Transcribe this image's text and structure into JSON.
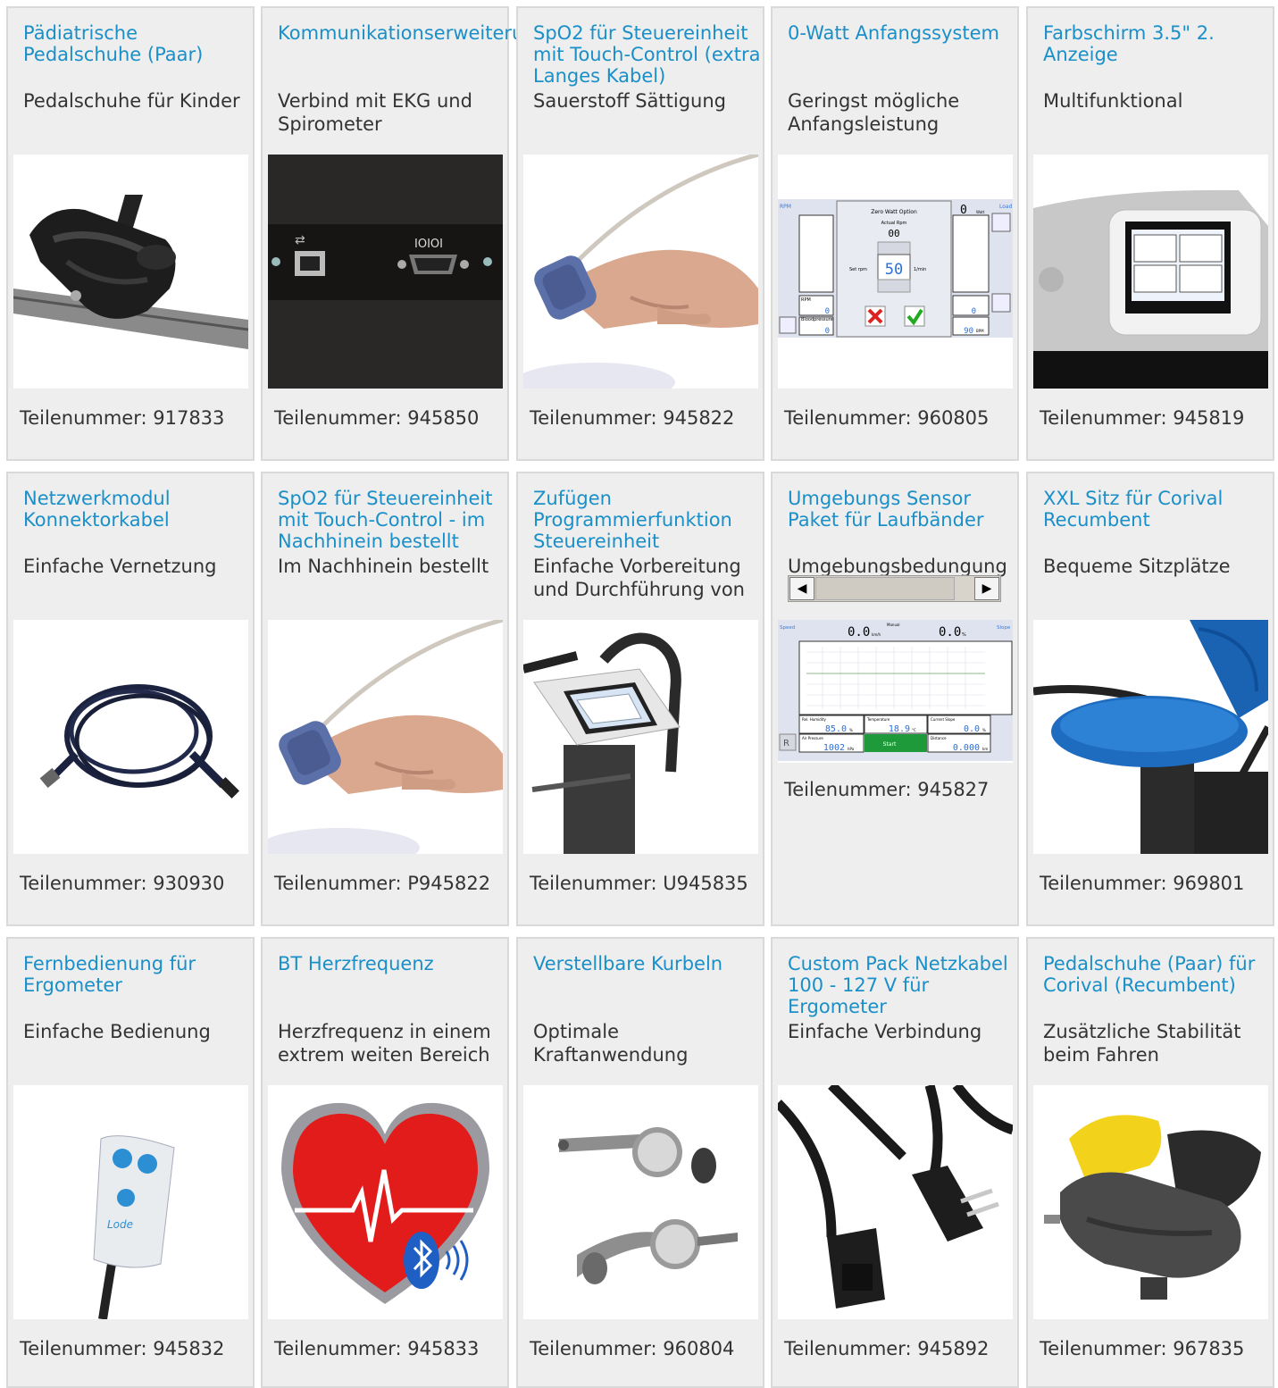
{
  "products": [
    {
      "title": "Pädiatrische Pedalschuhe (Paar)",
      "description": "Pedalschuhe für Kinder",
      "part": "Teilenummer: 917833",
      "image": "pediatric-pedal-shoe-image"
    },
    {
      "title": "Kommunikationserweiterungskarte",
      "description": "Verbind mit EKG und Spirometer",
      "part": "Teilenummer: 945850",
      "image": "communication-card-image"
    },
    {
      "title": "SpO2 für Steuereinheit mit Touch-Control (extra Langes Kabel)",
      "description": "Sauerstoff Sättigung",
      "part": "Teilenummer: 945822",
      "image": "spo2-sensor-image"
    },
    {
      "title": "0-Watt Anfangssystem",
      "description": "Geringst mögliche Anfangsleistung",
      "part": "Teilenummer: 960805",
      "image": "zero-watt-screen-image"
    },
    {
      "title": "Farbschirm 3.5\" 2. Anzeige",
      "description": "Multifunktional",
      "part": "Teilenummer: 945819",
      "image": "color-display-image"
    },
    {
      "title": "Netzwerkmodul Konnektorkabel",
      "description": "Einfache Vernetzung",
      "part": "Teilenummer: 930930",
      "image": "network-cable-image"
    },
    {
      "title": "SpO2 für Steuereinheit mit Touch-Control - im Nachhinein bestellt",
      "description": "Im Nachhinein bestellt",
      "part": "Teilenummer: P945822",
      "image": "spo2-sensor-image"
    },
    {
      "title": "Zufügen Programmierfunktion Steuereinheit",
      "description": "Einfache Vorbereitung und Durchführung von",
      "part": "Teilenummer: U945835",
      "image": "control-unit-image"
    },
    {
      "title": "Umgebungs Sensor Paket für Laufbänder",
      "description": "Umgebungsbedungung",
      "part": "Teilenummer: 945827",
      "image": "environment-screen-image"
    },
    {
      "title": "XXL Sitz für Corival Recumbent",
      "description": "Bequeme Sitzplätze",
      "part": "Teilenummer: 969801",
      "image": "xxl-seat-image"
    },
    {
      "title": "Fernbedienung für Ergometer",
      "description": "Einfache Bedienung",
      "part": "Teilenummer: 945832",
      "image": "remote-control-image"
    },
    {
      "title": "BT Herzfrequenz",
      "description": "Herzfrequenz in einem extrem weiten Bereich",
      "part": "Teilenummer: 945833",
      "image": "bt-heart-image"
    },
    {
      "title": "Verstellbare Kurbeln",
      "description": "Optimale Kraftanwendung",
      "part": "Teilenummer: 960804",
      "image": "adjustable-cranks-image"
    },
    {
      "title": "Custom Pack Netzkabel 100 - 127 V für Ergometer",
      "description": "Einfache Verbindung",
      "part": "Teilenummer: 945892",
      "image": "power-cable-image"
    },
    {
      "title": "Pedalschuhe (Paar) für Corival (Recumbent)",
      "description": "Zusätzliche Stabilität beim Fahren",
      "part": "Teilenummer: 967835",
      "image": "corival-pedal-shoe-image"
    }
  ],
  "screens": {
    "zero_watt": {
      "rpm_label": "RPM",
      "load_label": "Load",
      "watt_unit": "Watt",
      "dialog_title": "Zero Watt Option",
      "actual_rpm_label": "Actual Rpm",
      "actual_rpm_value": "00",
      "set_rpm_label": "Set rpm",
      "set_rpm_value": "50",
      "rpm_unit": "1/min",
      "rpm_panel_label": "RPM",
      "rpm_panel_value": "0",
      "bp_label": "Bloodpressure",
      "bp_value": "0",
      "watt_value": "0",
      "bpm_value": "90",
      "bpm_unit": "BPM",
      "top_value": "0"
    },
    "environment": {
      "speed_label": "Speed",
      "speed_value": "0.0",
      "speed_unit": "km/h",
      "mode_label": "Manual",
      "slope_value": "0.0",
      "slope_unit": "%",
      "slope_label": "Slope",
      "humidity_label": "Rel. Humidity",
      "humidity_value": "85.0",
      "humidity_unit": "%",
      "temperature_label": "Temperature",
      "temperature_value": "18.9",
      "temperature_unit": "°C",
      "current_slope_label": "Current Slope",
      "current_slope_value": "0.0",
      "current_slope_unit": "%",
      "air_pressure_label": "Air Pressure",
      "air_pressure_value": "1002",
      "air_pressure_unit": "hPa",
      "start_label": "Start",
      "distance_label": "Distance",
      "distance_value": "0.000",
      "distance_unit": "km",
      "reset_label": "R"
    },
    "communication_card": {
      "serial_label": "IOIOI"
    },
    "remote": {
      "brand": "Lode"
    }
  },
  "colors": {
    "title": "#1a8fc8",
    "text": "#333333",
    "card_bg": "#eeeeee",
    "card_border": "#d9d9d9"
  }
}
